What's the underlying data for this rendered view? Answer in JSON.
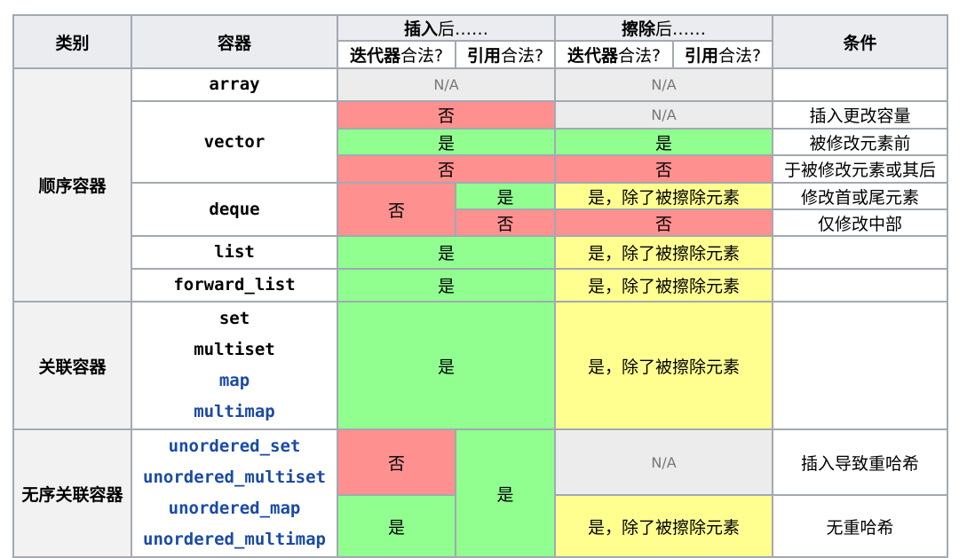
{
  "header": {
    "category": "类别",
    "container": "容器",
    "after_insert_bold": "插入",
    "after_insert_rest": "后……",
    "after_erase_bold": "擦除",
    "after_erase_rest": "后……",
    "condition": "条件",
    "iter_valid_bold": "迭代器",
    "iter_valid_rest": "合法?",
    "ref_valid_bold": "引用",
    "ref_valid_rest": "合法?"
  },
  "categories": {
    "sequence": "顺序容器",
    "associative": "关联容器",
    "unordered": "无序关联容器"
  },
  "containers": {
    "array": "array",
    "vector": "vector",
    "deque": "deque",
    "list": "list",
    "forward_list": "forward_list",
    "set": "set",
    "multiset": "multiset",
    "map": "map",
    "multimap": "multimap",
    "unordered_set": "unordered_set",
    "unordered_multiset": "unordered_multiset",
    "unordered_map": "unordered_map",
    "unordered_multimap": "unordered_multimap"
  },
  "values": {
    "yes": "是",
    "no": "否",
    "na": "N/A",
    "yes_except_erased": "是，除了被擦除元素"
  },
  "conditions": {
    "insert_changes_capacity": "插入更改容量",
    "before_modified": "被修改元素前",
    "at_or_after_modified": "于被修改元素或其后",
    "modify_front_back": "修改首或尾元素",
    "modify_middle_only": "仅修改中部",
    "insert_causes_rehash": "插入导致重哈希",
    "no_rehash": "无重哈希"
  },
  "colors": {
    "yes": "#90ff90",
    "no": "#ff9090",
    "partial": "#ffff90",
    "na": "#ececec",
    "header": "#eaecf0",
    "border": "#a2a9b1"
  }
}
